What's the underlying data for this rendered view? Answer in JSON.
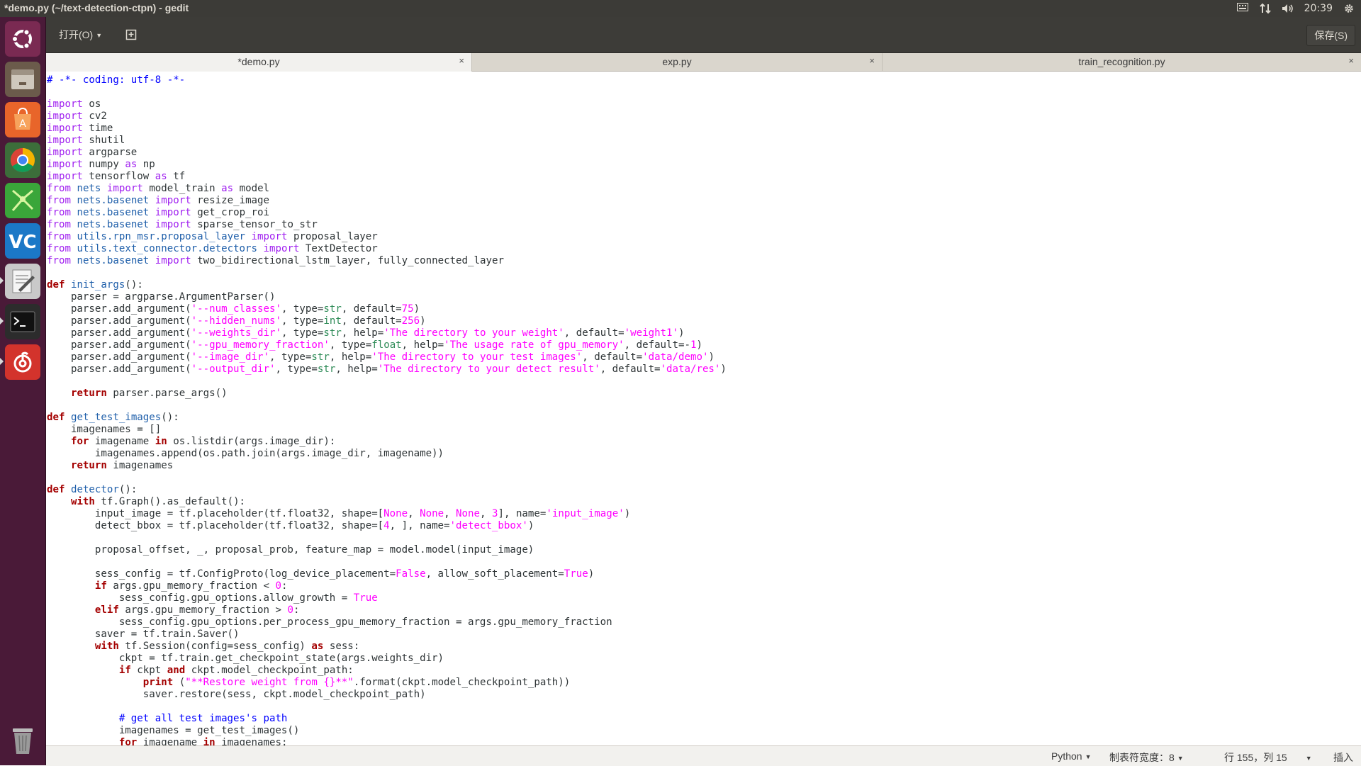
{
  "window": {
    "title": "*demo.py (~/text-detection-ctpn) - gedit"
  },
  "topbar": {
    "clock": "20:39"
  },
  "header": {
    "open_label": "打开(O)",
    "save_label": "保存(S)"
  },
  "tabs": [
    {
      "label": "*demo.py",
      "active": true
    },
    {
      "label": "exp.py",
      "active": false
    },
    {
      "label": "train_recognition.py",
      "active": false
    }
  ],
  "statusbar": {
    "language": "Python",
    "tab_width": "制表符宽度：8",
    "cursor": "行 155，列 15",
    "mode": "插入"
  },
  "code_lines": [
    "# -*- coding: utf-8 -*-",
    "",
    "import os",
    "import cv2",
    "import time",
    "import shutil",
    "import argparse",
    "import numpy as np",
    "import tensorflow as tf",
    "from nets import model_train as model",
    "from nets.basenet import resize_image",
    "from nets.basenet import get_crop_roi",
    "from nets.basenet import sparse_tensor_to_str",
    "from utils.rpn_msr.proposal_layer import proposal_layer",
    "from utils.text_connector.detectors import TextDetector",
    "from nets.basenet import two_bidirectional_lstm_layer, fully_connected_layer",
    "",
    "def init_args():",
    "    parser = argparse.ArgumentParser()",
    "    parser.add_argument('--num_classes', type=str, default=75)",
    "    parser.add_argument('--hidden_nums', type=int, default=256)",
    "    parser.add_argument('--weights_dir', type=str, help='The directory to your weight', default='weight1')",
    "    parser.add_argument('--gpu_memory_fraction', type=float, help='The usage rate of gpu_memory', default=-1)",
    "    parser.add_argument('--image_dir', type=str, help='The directory to your test images', default='data/demo')",
    "    parser.add_argument('--output_dir', type=str, help='The directory to your detect result', default='data/res')",
    "",
    "    return parser.parse_args()",
    "",
    "def get_test_images():",
    "    imagenames = []",
    "    for imagename in os.listdir(args.image_dir):",
    "        imagenames.append(os.path.join(args.image_dir, imagename))",
    "    return imagenames",
    "",
    "def detector():",
    "    with tf.Graph().as_default():",
    "        input_image = tf.placeholder(tf.float32, shape=[None, None, None, 3], name='input_image')",
    "        detect_bbox = tf.placeholder(tf.float32, shape=[4, ], name='detect_bbox')",
    "",
    "        proposal_offset, _, proposal_prob, feature_map = model.model(input_image)",
    "",
    "        sess_config = tf.ConfigProto(log_device_placement=False, allow_soft_placement=True)",
    "        if args.gpu_memory_fraction < 0:",
    "            sess_config.gpu_options.allow_growth = True",
    "        elif args.gpu_memory_fraction > 0:",
    "            sess_config.gpu_options.per_process_gpu_memory_fraction = args.gpu_memory_fraction",
    "        saver = tf.train.Saver()",
    "        with tf.Session(config=sess_config) as sess:",
    "            ckpt = tf.train.get_checkpoint_state(args.weights_dir)",
    "            if ckpt and ckpt.model_checkpoint_path:",
    "                print (\"**Restore weight from {}**\".format(ckpt.model_checkpoint_path))",
    "                saver.restore(sess, ckpt.model_checkpoint_path)",
    "",
    "            # get all test images's path",
    "            imagenames = get_test_images()",
    "            for imagename in imagenames:"
  ],
  "launcher": [
    {
      "icon": "ubuntu-dash-icon",
      "color": "#e05a2b"
    },
    {
      "icon": "files-icon",
      "color": "#8a7a68"
    },
    {
      "icon": "software-center-icon",
      "color": "#e8652a"
    },
    {
      "icon": "chrome-icon",
      "color": "#4a8ad8"
    },
    {
      "icon": "xmind-icon",
      "color": "#3aa63a"
    },
    {
      "icon": "vscode-icon",
      "color": "#1b78c7"
    },
    {
      "icon": "text-editor-icon",
      "color": "#d9d9d9"
    },
    {
      "icon": "terminal-icon",
      "color": "#333333"
    },
    {
      "icon": "netease-music-icon",
      "color": "#d3332c"
    },
    {
      "icon": "trash-icon",
      "color": "#a0a0a0"
    }
  ]
}
